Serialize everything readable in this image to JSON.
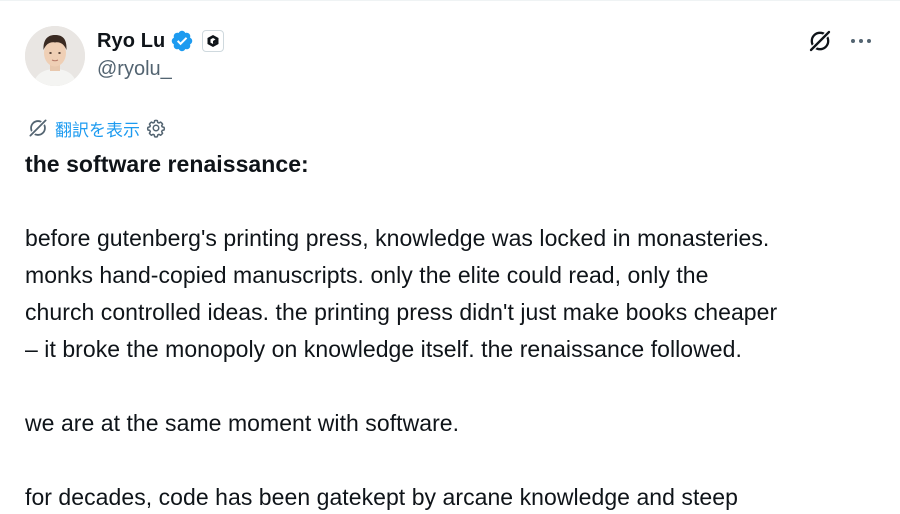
{
  "author": {
    "display_name": "Ryo Lu",
    "handle": "@ryolu_"
  },
  "icons": {
    "avatar": "avatar-photo",
    "verified": "verified-badge-icon",
    "affiliate": "affiliate-badge-icon",
    "grok": "grok-icon",
    "more": "more-icon",
    "translate": "grok-icon",
    "settings": "gear-icon"
  },
  "colors": {
    "accent": "#1d9bf0",
    "text": "#0f1419",
    "secondary_text": "#536471"
  },
  "translate": {
    "label": "翻訳を表示"
  },
  "post": {
    "title": "the software renaissance:",
    "paragraph1": {
      "line1": "before gutenberg's printing press, knowledge was locked in monasteries.",
      "line2": "monks hand-copied manuscripts. only the elite could read, only the",
      "line3": "church controlled ideas. the printing press didn't just make books cheaper",
      "line4": "– it broke the monopoly on knowledge itself. the renaissance followed."
    },
    "paragraph2": "we are at the same moment with software.",
    "paragraph3_partial": "for decades, code has been gatekept by arcane knowledge and steep"
  }
}
